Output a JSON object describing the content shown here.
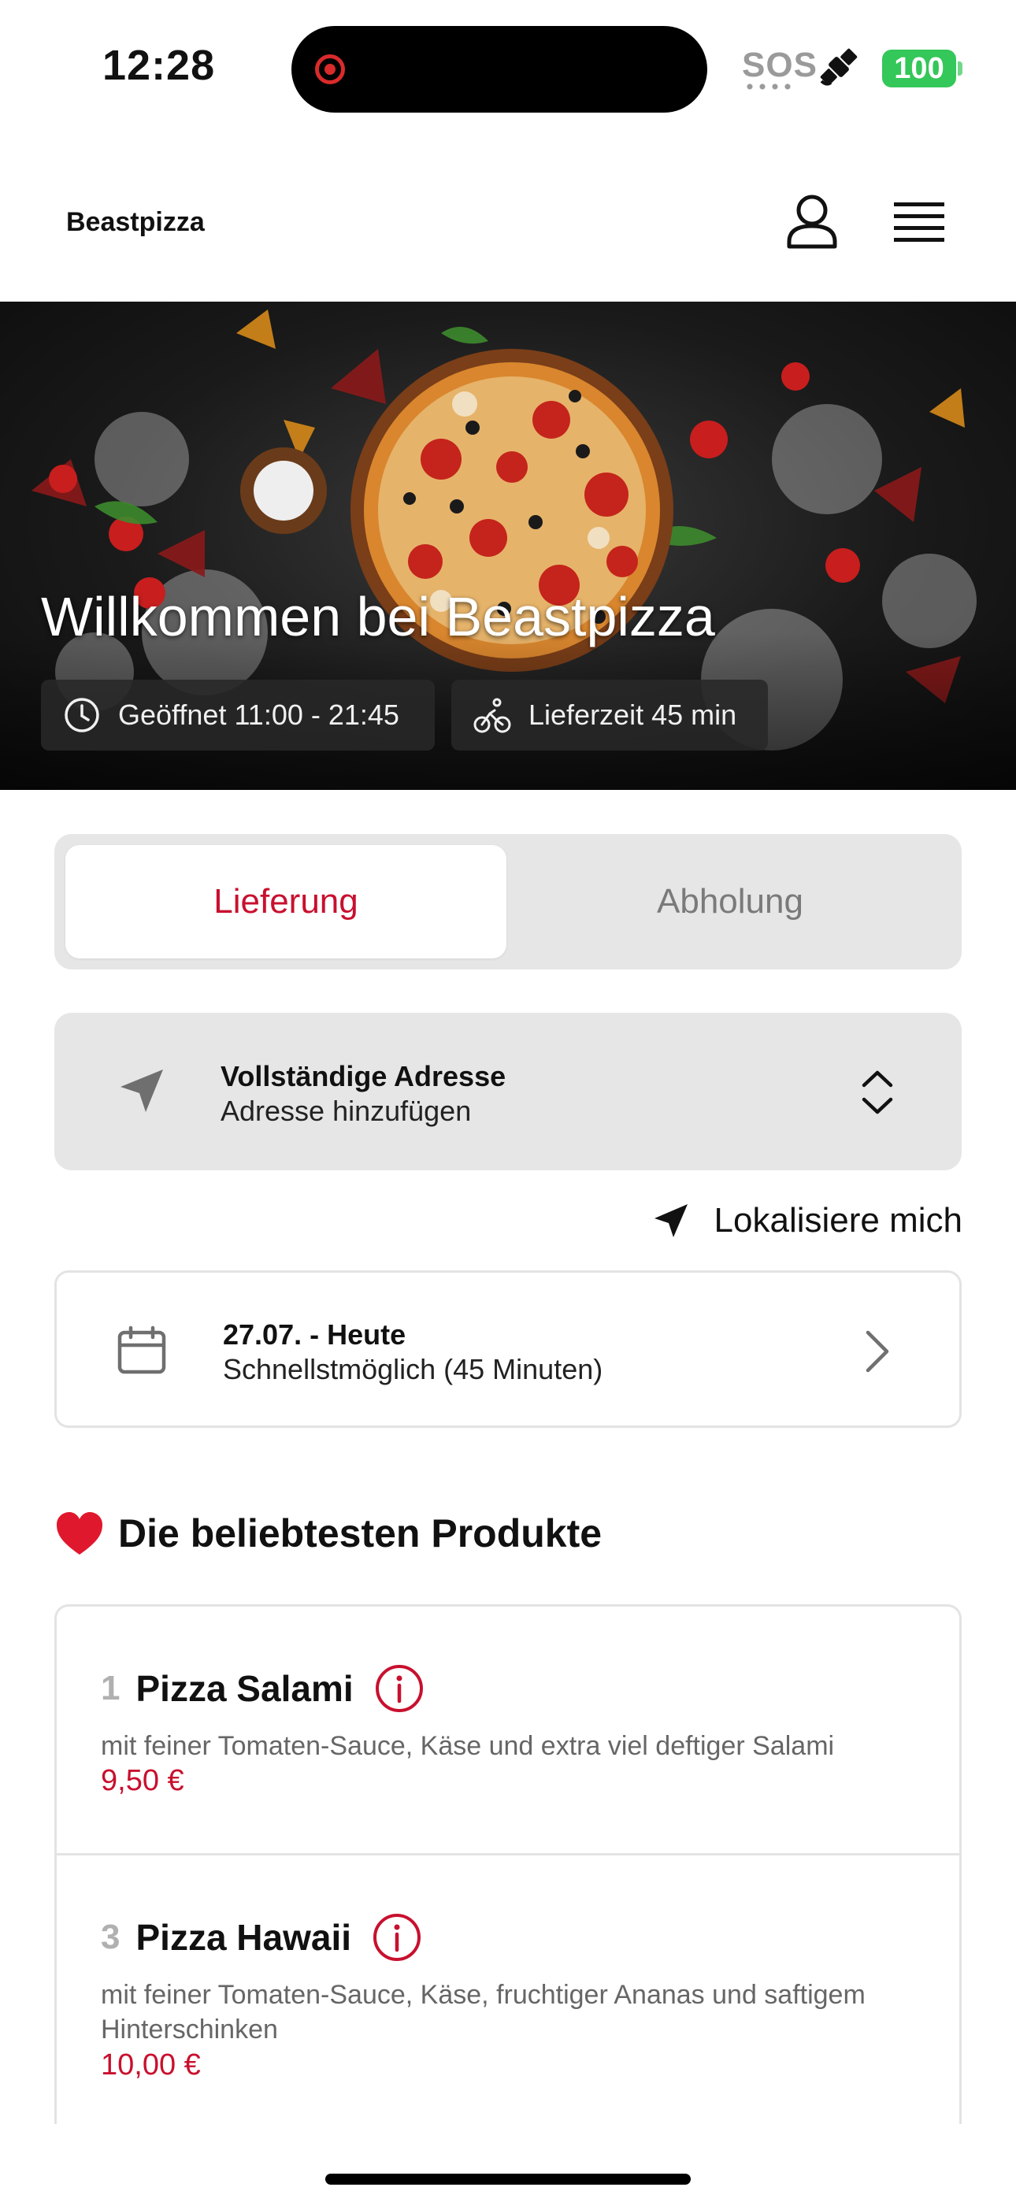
{
  "status_bar": {
    "time": "12:28",
    "sos": "SOS",
    "battery": "100",
    "icons": [
      "screen-recording-icon",
      "satellite-icon",
      "battery-icon"
    ]
  },
  "header": {
    "brand": "Beastpizza",
    "icons": [
      "user-icon",
      "hamburger-menu-icon"
    ]
  },
  "hero": {
    "title": "Willkommen bei Beastpizza",
    "opening_hours": "Geöffnet 11:00 - 21:45",
    "delivery_time": "Lieferzeit 45 min"
  },
  "mode_toggle": {
    "options": [
      "Lieferung",
      "Abholung"
    ],
    "selected": "Lieferung"
  },
  "address": {
    "title": "Vollständige Adresse",
    "subtitle": "Adresse hinzufügen"
  },
  "locate_label": "Lokalisiere mich",
  "schedule": {
    "title": "27.07. - Heute",
    "subtitle": "Schnellstmöglich (45 Minuten)"
  },
  "popular": {
    "heading": "Die beliebtesten Produkte",
    "products": [
      {
        "number": "1",
        "name": "Pizza Salami",
        "description": "mit feiner Tomaten-Sauce, Käse und extra viel deftiger Salami",
        "price": "9,50 €"
      },
      {
        "number": "3",
        "name": "Pizza Hawaii",
        "description": "mit feiner Tomaten-Sauce, Käse, fruchtiger Ananas und saftigem Hinterschinken",
        "price": "10,00 €"
      }
    ]
  },
  "colors": {
    "accent": "#c8102e",
    "battery": "#34c759",
    "card_bg": "#e6e6e6"
  }
}
